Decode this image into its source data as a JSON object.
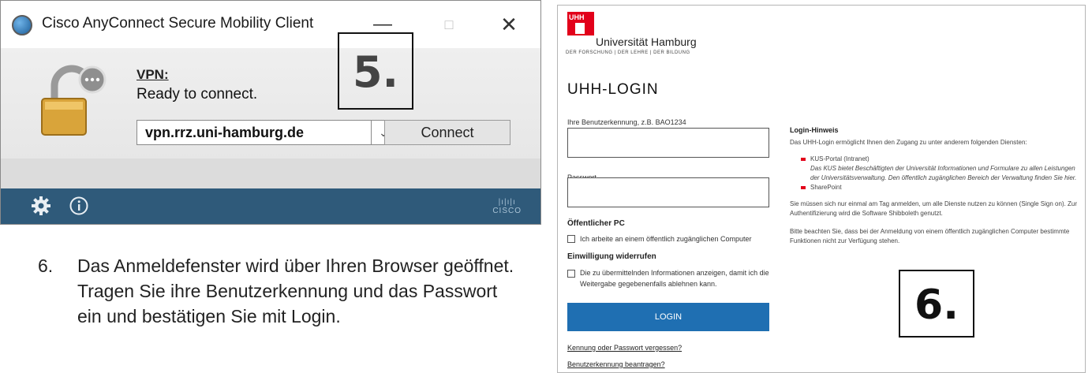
{
  "cisco": {
    "title": "Cisco AnyConnect Secure Mobility Client",
    "vpn_label": "VPN:",
    "status": "Ready to connect.",
    "server": "vpn.rrz.uni-hamburg.de",
    "connect_label": "Connect",
    "step": "5.",
    "icons": [
      "anyconnect-icon",
      "lock-icon",
      "gear-icon",
      "info-icon",
      "cisco-logo"
    ]
  },
  "instruction": {
    "number": "6.",
    "text": "Das Anmeldefenster wird über Ihren Browser geöffnet. Tragen Sie ihre Benutzerkennung und das Passwort ein und bestätigen Sie mit Login."
  },
  "uhh": {
    "logo_abbr": "UHH",
    "university": "Universität Hamburg",
    "tagline": "DER FORSCHUNG | DER LEHRE | DER BILDUNG",
    "heading": "UHH-LOGIN",
    "username_label": "Ihre Benutzerkennung, z.B. BAO1234",
    "password_label": "Passwort",
    "public_pc_title": "Öffentlicher PC",
    "public_pc_checkbox": "Ich arbeite an einem öffentlich zugänglichen Computer",
    "revoke_title": "Einwilligung widerrufen",
    "revoke_checkbox": "Die zu übermittelnden Informationen anzeigen, damit ich die Weitergabe gegebenenfalls ablehnen kann.",
    "login_label": "LOGIN",
    "forgot_link": "Kennung oder Passwort vergessen?",
    "request_link": "Benutzerkennung beantragen?",
    "hint_title": "Login-Hinweis",
    "hint_intro": "Das UHH-Login ermöglicht Ihnen den Zugang zu unter anderem folgenden Diensten:",
    "service_1": "KUS-Portal (Intranet)",
    "service_1_desc": "Das KUS bietet Beschäftigten der Universität Informationen und Formulare zu allen Leistungen der Universitätsverwaltung. Den öffentlich zugänglichen Bereich der Verwaltung finden Sie hier.",
    "service_2": "SharePoint",
    "sso_text": "Sie müssen sich nur einmal am Tag anmelden, um alle Dienste nutzen zu können (Single Sign on). Zur Authentifizierung wird die Software Shibboleth genutzt.",
    "public_note": "Bitte beachten Sie, dass bei der Anmeldung von einem öffentlich zugänglichen Computer bestimmte Funktionen nicht zur Verfügung stehen.",
    "step": "6."
  }
}
